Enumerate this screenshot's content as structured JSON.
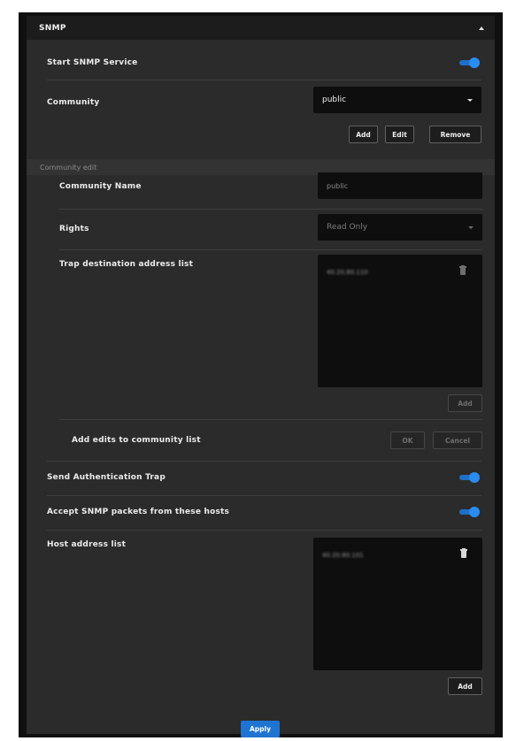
{
  "panel": {
    "title": "SNMP",
    "toggle_icon": "chevron-up-icon"
  },
  "start_service": {
    "label": "Start SNMP Service",
    "enabled": true
  },
  "community": {
    "label": "Community",
    "selected": "public",
    "buttons": {
      "add": "Add",
      "edit": "Edit",
      "remove": "Remove"
    }
  },
  "community_edit": {
    "section_title": "Community edit",
    "name_label": "Community Name",
    "name_value": "public",
    "rights_label": "Rights",
    "rights_value": "Read Only",
    "trap_label": "Trap destination address list",
    "trap_entries": [
      "40.20.80.110"
    ],
    "trap_add": "Add",
    "add_edits_label": "Add edits to community list",
    "ok": "OK",
    "cancel": "Cancel"
  },
  "auth_trap": {
    "label": "Send Authentication Trap",
    "enabled": true
  },
  "accept_hosts": {
    "label": "Accept SNMP packets from these hosts",
    "enabled": true
  },
  "host_list": {
    "label": "Host address list",
    "entries": [
      "40.20.80.101"
    ],
    "add": "Add"
  },
  "apply": "Apply",
  "colors": {
    "accent": "#1e74d0",
    "panel_bg": "#2b2b2b",
    "field_bg": "#0e0e0e"
  }
}
